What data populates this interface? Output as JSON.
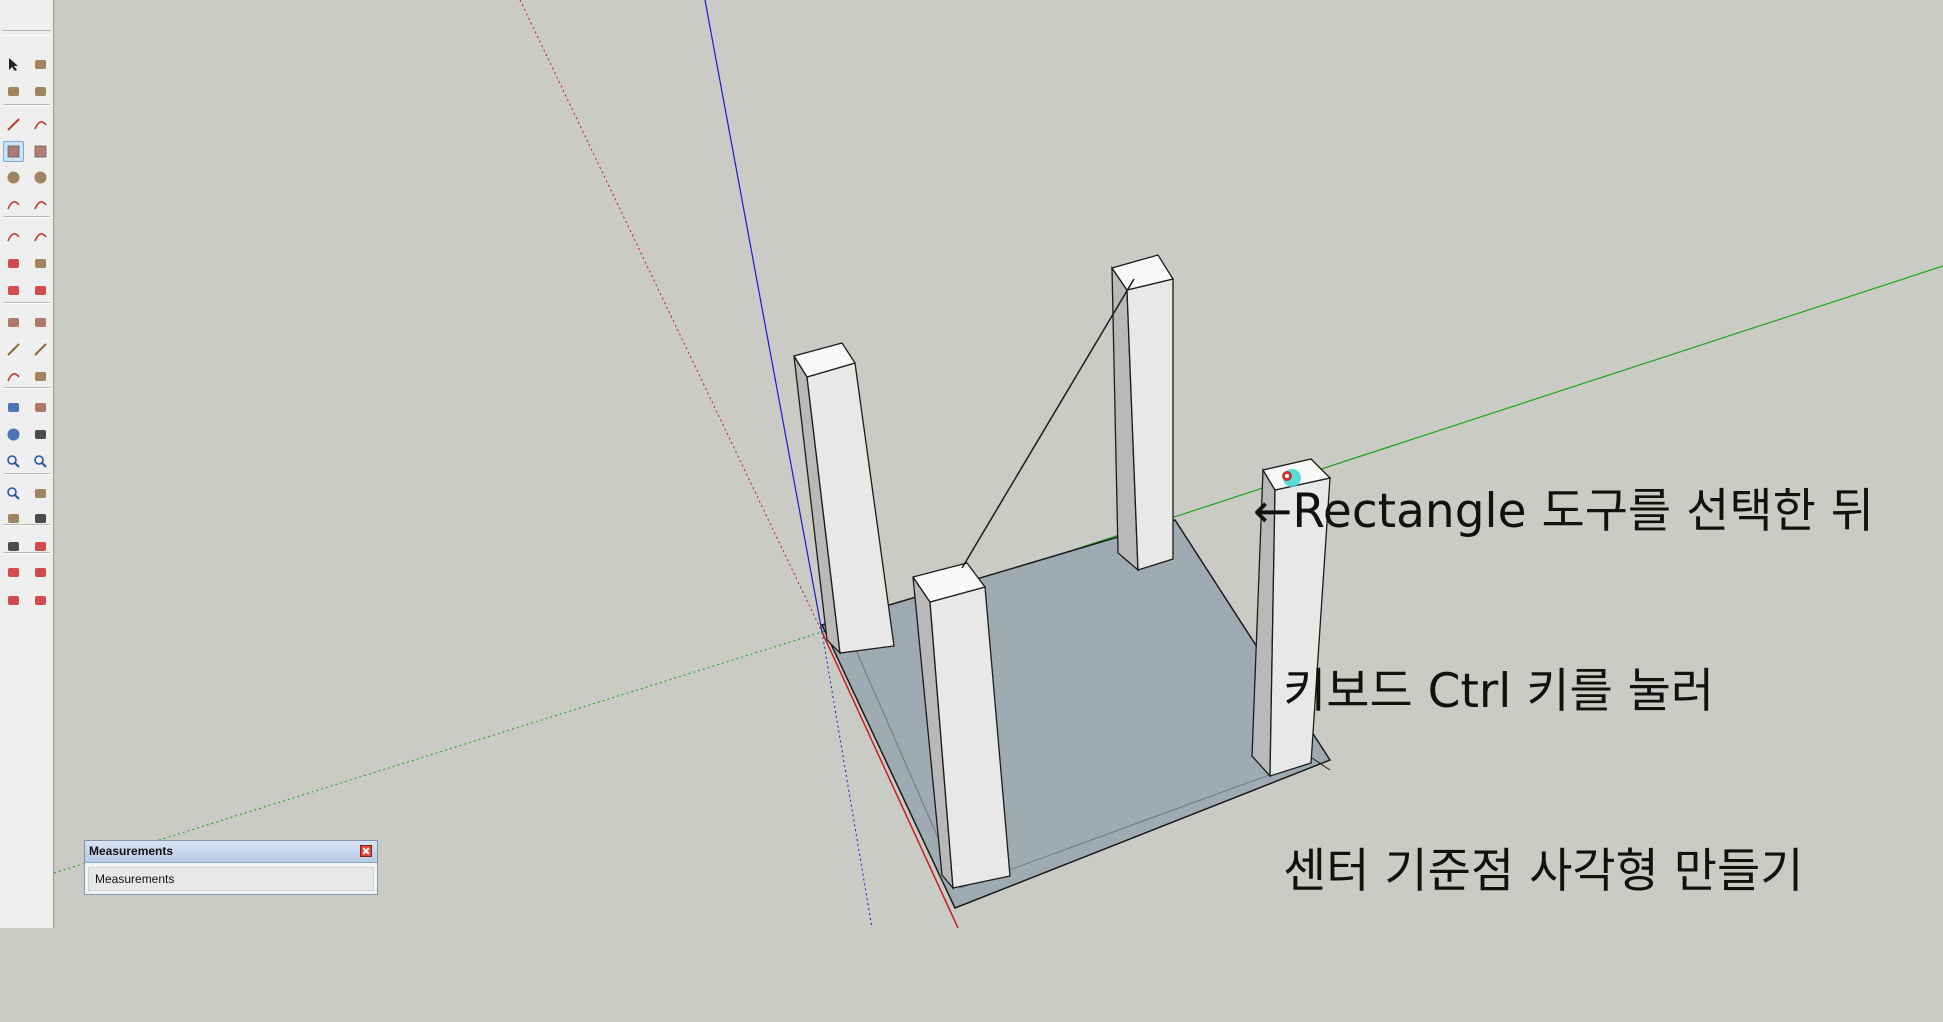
{
  "annotation": {
    "line1": "←Rectangle 도구를 선택한 뒤",
    "line2": "키보드 Ctrl 키를 눌러",
    "line3": "센터 기준점 사각형 만들기"
  },
  "measurements": {
    "title": "Measurements",
    "label": "Measurements"
  },
  "toolbar": {
    "active_tool": "rectangle",
    "tools": [
      "select-icon",
      "make-component-icon",
      "paint-bucket-icon",
      "eraser-icon",
      "line-icon",
      "freehand-icon",
      "rectangle-icon",
      "rotated-rectangle-icon",
      "circle-icon",
      "polygon-icon",
      "arc-icon",
      "pie-icon",
      "two-point-arc-icon",
      "three-point-arc-icon",
      "move-icon",
      "push-pull-icon",
      "rotate-icon",
      "follow-me-icon",
      "scale-icon",
      "offset-icon",
      "tape-measure-icon",
      "dimension-icon",
      "protractor-icon",
      "text-icon",
      "axes-icon",
      "3d-text-icon",
      "orbit-icon",
      "pan-icon",
      "zoom-icon",
      "zoom-window-icon",
      "zoom-extents-icon",
      "previous-view-icon",
      "position-camera-icon",
      "look-around-icon",
      "walk-icon",
      "section-plane-icon",
      "warehouse-icon",
      "share-model-icon",
      "extension-warehouse-icon",
      "layout-icon"
    ]
  },
  "colors": {
    "background": "#cbcbc6",
    "floor": "#9eabb3",
    "red_axis": "#c81e1e",
    "green_axis": "#19a519",
    "blue_axis": "#1a1ad2"
  }
}
